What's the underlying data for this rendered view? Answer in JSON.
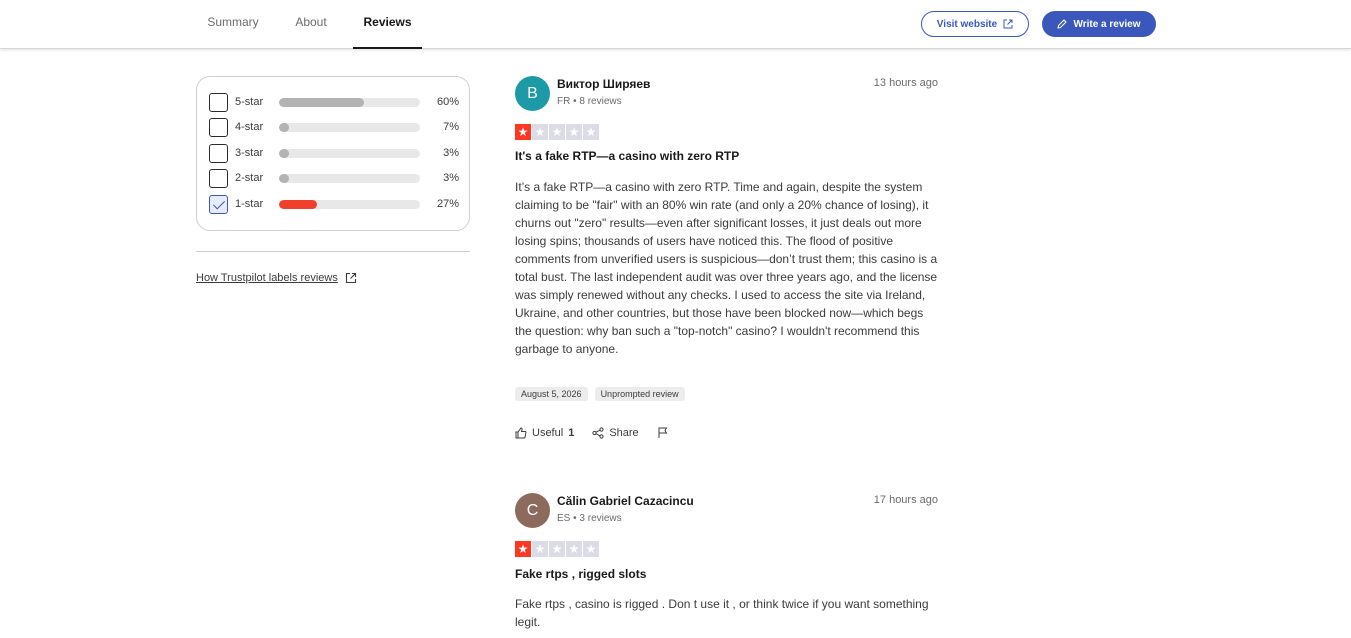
{
  "nav": {
    "tabs": [
      {
        "label": "Summary",
        "active": false
      },
      {
        "label": "About",
        "active": false
      },
      {
        "label": "Reviews",
        "active": true
      }
    ],
    "visit_label": "Visit website",
    "write_label": "Write a review",
    "accent": "#3c57bc"
  },
  "filters": [
    {
      "label": "5-star",
      "percent_text": "60%",
      "fill": 0.6,
      "checked": false
    },
    {
      "label": "4-star",
      "percent_text": "7%",
      "fill": 0.07,
      "checked": false
    },
    {
      "label": "3-star",
      "percent_text": "3%",
      "fill": 0.03,
      "checked": false
    },
    {
      "label": "2-star",
      "percent_text": "3%",
      "fill": 0.03,
      "checked": false
    },
    {
      "label": "1-star",
      "percent_text": "27%",
      "fill": 0.27,
      "checked": true
    }
  ],
  "labels_link": "How Trustpilot labels reviews",
  "reviews": [
    {
      "initial": "B",
      "avatar_color": "#1c9aa6",
      "author": "Виктор Ширяев",
      "meta": "FR • 8 reviews",
      "time": "13 hours ago",
      "rating": 1,
      "title": "It's a fake RTP—a casino with zero RTP",
      "body": "It’s a fake RTP—a casino with zero RTP. Time and again, despite the system claiming to be \"fair\" with an 80% win rate (and only a 20% chance of losing), it churns out \"zero\" results—even after significant losses, it just deals out more losing spins; thousands of users have noticed this. The flood of positive comments from unverified users is suspicious—don’t trust them; this casino is a total bust. The last independent audit was over three years ago, and the license was simply renewed without any checks. I used to access the site via Ireland, Ukraine, and other countries, but those have been blocked now—which begs the question: why ban such a \"top-notch\" casino? I wouldn't recommend this garbage to anyone.",
      "date": "August 5, 2026",
      "tag": "Unprompted review",
      "useful_label": "Useful",
      "useful_count": "1",
      "share_label": "Share"
    },
    {
      "initial": "C",
      "avatar_color": "#8c6a5e",
      "author": "Călin Gabriel Cazacincu",
      "meta": "ES • 3 reviews",
      "time": "17 hours ago",
      "rating": 1,
      "title": "Fake rtps , rigged slots",
      "body": "Fake rtps , casino is rigged . Don t use it , or think twice if you want something legit."
    }
  ]
}
